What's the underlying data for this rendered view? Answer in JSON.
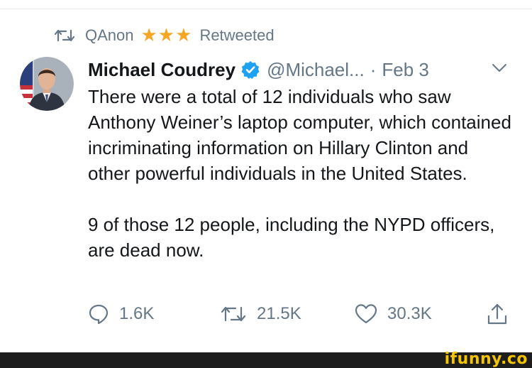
{
  "retweet_context": {
    "retweeter": "QAnon",
    "stars": "★★★",
    "label": "Retweeted"
  },
  "tweet": {
    "author": {
      "display_name": "Michael Coudrey",
      "handle": "@Michael...",
      "verified": true
    },
    "separator": "·",
    "date": "Feb 3",
    "paragraphs": [
      "There were a total of 12 individuals who saw Anthony Weiner’s laptop computer, which contained incriminating information on Hillary Clinton and other powerful individuals in the United States.",
      "9 of those 12 people, including the NYPD officers, are dead now."
    ],
    "actions": {
      "reply_count": "1.6K",
      "retweet_count": "21.5K",
      "like_count": "30.3K"
    }
  },
  "watermark": "ifunny.co",
  "colors": {
    "text": "#14171a",
    "secondary": "#657786",
    "verified": "#1da1f2",
    "stars": "#f5a623",
    "watermark": "#f5c400"
  }
}
